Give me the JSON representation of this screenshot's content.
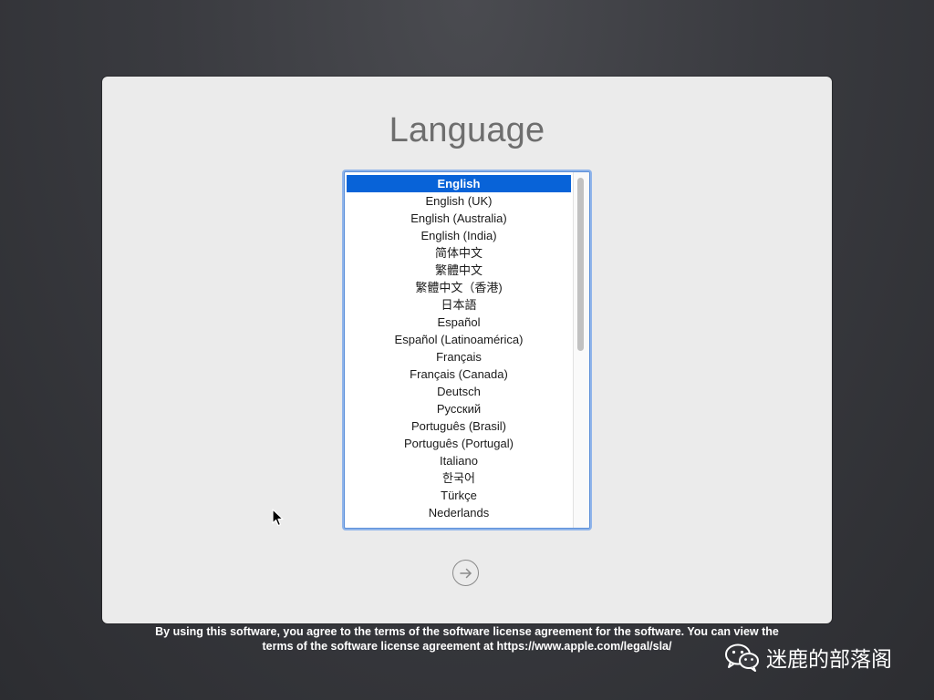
{
  "installer": {
    "title": "Language",
    "languages": [
      "English",
      "English (UK)",
      "English (Australia)",
      "English (India)",
      "简体中文",
      "繁體中文",
      "繁體中文（香港)",
      "日本語",
      "Español",
      "Español (Latinoamérica)",
      "Français",
      "Français (Canada)",
      "Deutsch",
      "Русский",
      "Português (Brasil)",
      "Português (Portugal)",
      "Italiano",
      "한국어",
      "Türkçe",
      "Nederlands"
    ],
    "selected_language": "English",
    "next_icon": "arrow-right-circle-icon"
  },
  "footer": {
    "legal_line1": "By using this software, you agree to the terms of the software license agreement for the software. You can view the",
    "legal_line2": "terms of the software license agreement at https://www.apple.com/legal/sla/"
  },
  "watermark": {
    "text": "迷鹿的部落阁",
    "icon": "wechat-icon"
  },
  "colors": {
    "selection": "#0863d8",
    "focus_ring": "#8fb4ea",
    "panel": "#ebebeb"
  }
}
